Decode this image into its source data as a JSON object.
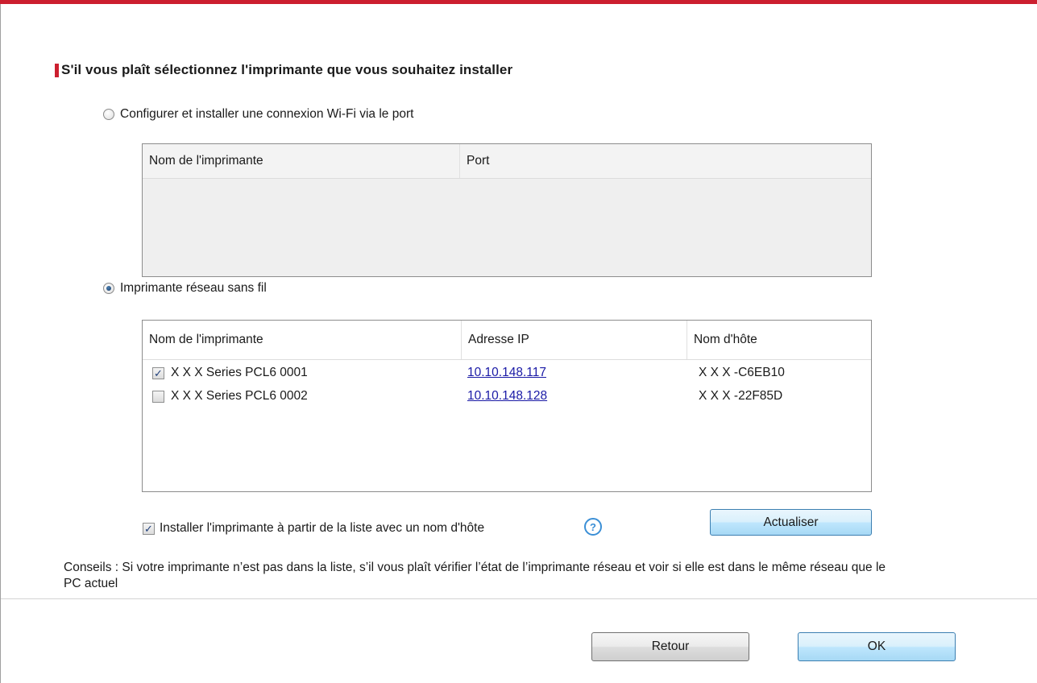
{
  "colors": {
    "accent_red": "#cc1f2f",
    "link_blue": "#1a1aa6"
  },
  "title": "S'il vous plaît sélectionnez l'imprimante que vous souhaitez installer",
  "option_port": {
    "label": "Configurer et installer une connexion Wi-Fi via le port",
    "selected": false,
    "columns": [
      "Nom de l'imprimante",
      "Port"
    ]
  },
  "option_wireless": {
    "label": "Imprimante réseau sans fil",
    "selected": true,
    "columns": [
      "Nom de l'imprimante",
      "Adresse IP",
      "Nom d'hôte"
    ],
    "rows": [
      {
        "name": "X X X  Series PCL6 0001",
        "ip": "10.10.148.117",
        "host": "X X X -C6EB10",
        "checked": true
      },
      {
        "name": "X X X  Series PCL6 0002",
        "ip": "10.10.148.128",
        "host": "X X X -22F85D",
        "checked": false
      }
    ]
  },
  "hostname_checkbox": {
    "label": "Installer l'imprimante à partir de la liste avec un nom d'hôte",
    "checked": true,
    "help_icon": "question-circle-icon"
  },
  "refresh_button": "Actualiser",
  "hint": "Conseils : Si votre imprimante n’est pas dans la liste, s’il vous plaît vérifier l’état de l’imprimante réseau et voir si elle est dans le même réseau que le PC actuel",
  "footer": {
    "back_button": "Retour",
    "ok_button": "OK"
  }
}
